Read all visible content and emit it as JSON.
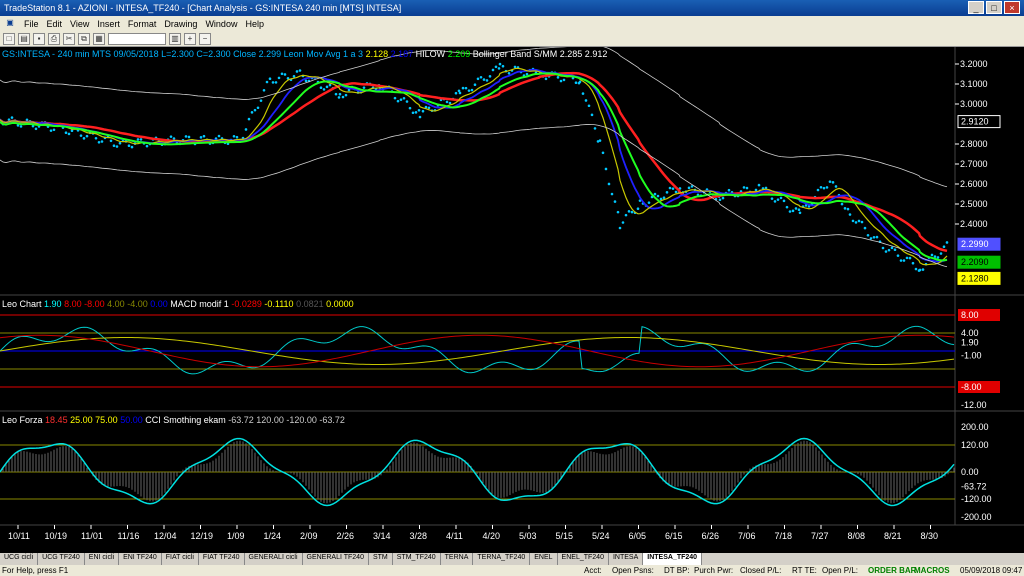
{
  "app": {
    "title": "TradeStation 8.1 - AZIONI - INTESA_TF240 - [Chart Analysis - GS:INTESA  240 min  [MTS] INTESA]",
    "menu": [
      "File",
      "Edit",
      "View",
      "Insert",
      "Format",
      "Drawing",
      "Window",
      "Help"
    ]
  },
  "legends": {
    "main": [
      {
        "text": "GS:INTESA - 240 min  MTS  09/05/2018  L=2.300  C=2.300  Close  2.299  Leon Mov Avg 1 a 3",
        "color": "#00b4ff"
      },
      {
        "text": "2.128",
        "color": "#ffff00"
      },
      {
        "text": "2.187",
        "color": "#0000ff"
      },
      {
        "text": "HILOW",
        "color": "#ffffff"
      },
      {
        "text": "2.209",
        "color": "#00ff00"
      },
      {
        "text": "Bollinger Band S/MM  2.285  2.912",
        "color": "#ffffff"
      }
    ],
    "pane2": [
      {
        "text": "Leo Chart",
        "color": "#ffffff"
      },
      {
        "text": "1.90",
        "color": "#00ffff"
      },
      {
        "text": "8.00",
        "color": "#ff0000"
      },
      {
        "text": "-8.00",
        "color": "#ff0000"
      },
      {
        "text": "4.00",
        "color": "#888800"
      },
      {
        "text": "-4.00",
        "color": "#888800"
      },
      {
        "text": "0.00",
        "color": "#0000ff"
      },
      {
        "text": "MACD modif 1",
        "color": "#ffffff"
      },
      {
        "text": "-0.0289",
        "color": "#ff0000"
      },
      {
        "text": "-0.1110",
        "color": "#ffff00"
      },
      {
        "text": "0.0821",
        "color": "#555555"
      },
      {
        "text": "0.0000",
        "color": "#ffff00"
      }
    ],
    "pane3": [
      {
        "text": "Leo Forza",
        "color": "#ffffff"
      },
      {
        "text": "18.45",
        "color": "#ff3030"
      },
      {
        "text": "25.00",
        "color": "#ffff00"
      },
      {
        "text": "75.00",
        "color": "#ffff00"
      },
      {
        "text": "50.00",
        "color": "#0000ff"
      },
      {
        "text": "CCI Smothing ekam",
        "color": "#ffffff"
      },
      {
        "text": "-63.72  120.00  -120.00  -63.72",
        "color": "#cccccc"
      }
    ]
  },
  "axis": {
    "price_ticks": [
      "3.2000",
      "3.1000",
      "3.0000",
      "2.8000",
      "2.7000",
      "2.6000",
      "2.5000",
      "2.4000"
    ],
    "price_tags": [
      {
        "label": "2.9120",
        "bg": "#000",
        "fg": "#fff",
        "border": "#fff"
      },
      {
        "label": "2.2990",
        "bg": "#5050ff",
        "fg": "#fff",
        "border": "#5050ff"
      },
      {
        "label": "2.2090",
        "bg": "#00c000",
        "fg": "#000",
        "border": "#00c000"
      },
      {
        "label": "2.1280",
        "bg": "#ffff00",
        "fg": "#000",
        "border": "#ffff00"
      }
    ],
    "pane2_ticks": [
      "8.00",
      "4.00",
      "1.90",
      "-1.00",
      "-8.00",
      "-12.00"
    ],
    "pane3_ticks": [
      "200.00",
      "120.00",
      "0.00",
      "-63.72",
      "-120.00",
      "-200.00"
    ],
    "dates": [
      "10/11",
      "10/19",
      "11/01",
      "11/16",
      "12/04",
      "12/19",
      "1/09",
      "1/24",
      "2/09",
      "2/26",
      "3/14",
      "3/28",
      "4/11",
      "4/20",
      "5/03",
      "5/15",
      "5/24",
      "6/05",
      "6/15",
      "6/26",
      "7/06",
      "7/18",
      "7/27",
      "8/08",
      "8/21",
      "8/30"
    ]
  },
  "tabs": [
    "UCG cicli",
    "UCG TF240",
    "ENI cicli",
    "ENI TF240",
    "FIAT cicli",
    "FIAT TF240",
    "GENERALI cicli",
    "GENERALI TF240",
    "STM",
    "STM_TF240",
    "TERNA",
    "TERNA_TF240",
    "ENEL",
    "ENEL_TF240",
    "INTESA",
    "INTESA_TF240"
  ],
  "active_tab": "INTESA_TF240",
  "status": {
    "help": "For Help, press F1",
    "acct": "Acct:",
    "open_psns": "Open Psns:",
    "dt_bp": "DT BP:",
    "purch_pwr": "Purch Pwr:",
    "closed_pl": "Closed P/L:",
    "rt_te": "RT TE:",
    "open_pl": "Open P/L:",
    "order_bar": "ORDER BAR",
    "macros": "MACROS",
    "datetime": "05/09/2018 09:47"
  },
  "colors": {
    "price": "#00c8ff",
    "ma_red": "#ff2020",
    "ma_green": "#20ff20",
    "ma_blue": "#2020ff",
    "ma_yellow": "#c8c800",
    "bollinger": "#d0d0d0"
  }
}
